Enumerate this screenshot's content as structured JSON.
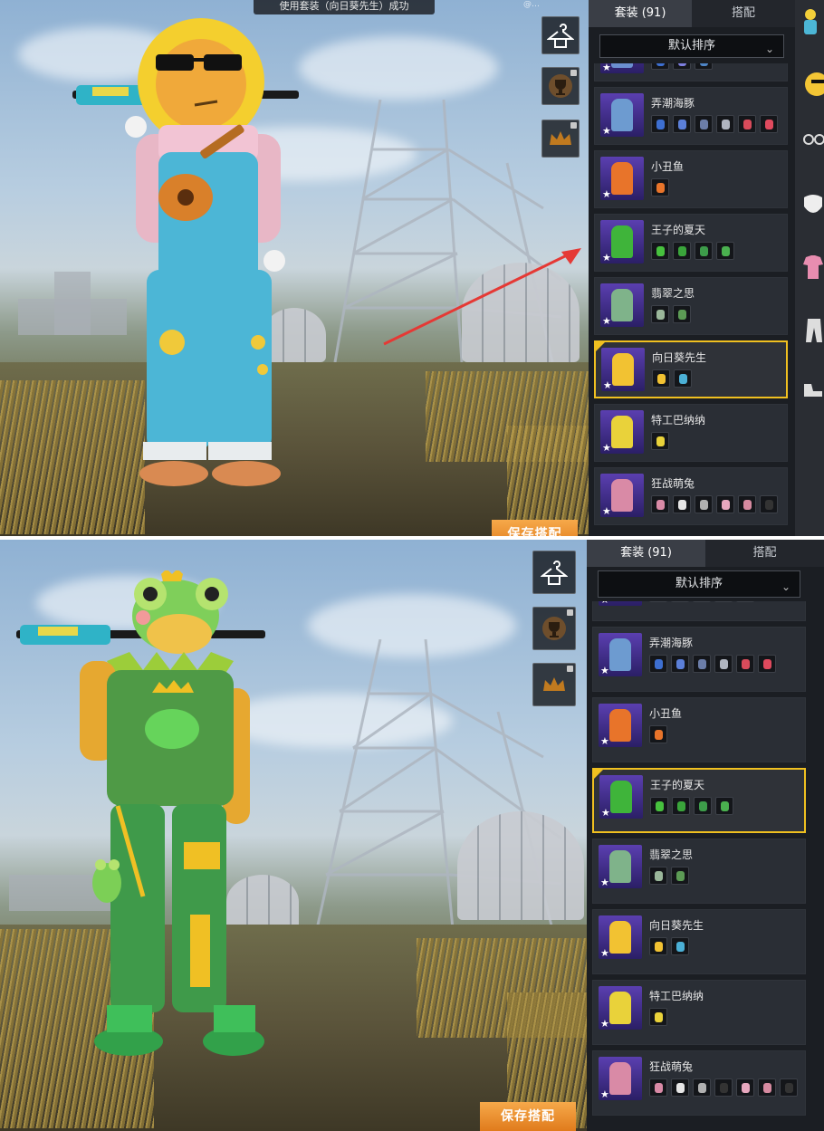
{
  "top": {
    "banner": "使用套装（向日葵先生）成功",
    "watermark": "@…",
    "tabs": [
      {
        "label": "套装 (91)",
        "active": true
      },
      {
        "label": "搭配",
        "active": false
      }
    ],
    "sort": "默认排序",
    "save": "保存搭配",
    "outfits": [
      {
        "name": "",
        "selected": false,
        "accent": "#6b8fd0",
        "parts": [
          "#3d6fd1",
          "#7e7fe0",
          "#4e86c8"
        ]
      },
      {
        "name": "弄潮海豚",
        "selected": false,
        "accent": "#6d9bd0",
        "parts": [
          "#3d6fd1",
          "#5b7fd8",
          "#6b7da8",
          "#b0b5c0",
          "#d94b5b",
          "#e04a5e"
        ]
      },
      {
        "name": "小丑鱼",
        "selected": false,
        "accent": "#e8742a",
        "parts": [
          "#e8742a"
        ]
      },
      {
        "name": "王子的夏天",
        "selected": false,
        "accent": "#3fb43a",
        "parts": [
          "#47c13e",
          "#3aa53b",
          "#3d9c4a",
          "#4ab04f"
        ]
      },
      {
        "name": "翡翠之思",
        "selected": false,
        "accent": "#7fb38a",
        "parts": [
          "#9ab79a",
          "#5c9b55"
        ]
      },
      {
        "name": "向日葵先生",
        "selected": true,
        "accent": "#f2c232",
        "parts": [
          "#f2c232",
          "#4bb0d6"
        ]
      },
      {
        "name": "特工巴纳纳",
        "selected": false,
        "accent": "#e9d23a",
        "parts": [
          "#e9d23a"
        ]
      },
      {
        "name": "狂战萌兔",
        "selected": false,
        "accent": "#d98aa6",
        "parts": [
          "#d98aa6",
          "#e6e6e6",
          "#b0b0b0",
          "#e7a7be",
          "#d68aa0",
          "#333333"
        ]
      }
    ]
  },
  "bottom": {
    "tabs": [
      {
        "label": "套装 (91)",
        "active": true
      },
      {
        "label": "搭配",
        "active": false
      }
    ],
    "sort": "默认排序",
    "save": "保存搭配",
    "outfits": [
      {
        "name": "",
        "selected": false,
        "accent": "#6b8fd0",
        "parts": [
          "#3d6fd1",
          "#7e7fe0",
          "#4e86c8",
          "#4e86c8",
          "#4e86c8"
        ]
      },
      {
        "name": "弄潮海豚",
        "selected": false,
        "accent": "#6d9bd0",
        "parts": [
          "#3d6fd1",
          "#5b7fd8",
          "#6b7da8",
          "#b0b5c0",
          "#d94b5b",
          "#e04a5e"
        ]
      },
      {
        "name": "小丑鱼",
        "selected": false,
        "accent": "#e8742a",
        "parts": [
          "#e8742a"
        ]
      },
      {
        "name": "王子的夏天",
        "selected": true,
        "accent": "#3fb43a",
        "parts": [
          "#47c13e",
          "#3aa53b",
          "#3d9c4a",
          "#4ab04f"
        ]
      },
      {
        "name": "翡翠之思",
        "selected": false,
        "accent": "#7fb38a",
        "parts": [
          "#9ab79a",
          "#5c9b55"
        ]
      },
      {
        "name": "向日葵先生",
        "selected": false,
        "accent": "#f2c232",
        "parts": [
          "#f2c232",
          "#4bb0d6"
        ]
      },
      {
        "name": "特工巴纳纳",
        "selected": false,
        "accent": "#e9d23a",
        "parts": [
          "#e9d23a"
        ]
      },
      {
        "name": "狂战萌兔",
        "selected": false,
        "accent": "#d98aa6",
        "parts": [
          "#d98aa6",
          "#e6e6e6",
          "#b0b0b0",
          "#333333",
          "#e7a7be",
          "#d68aa0",
          "#333333"
        ]
      }
    ]
  },
  "icons": {
    "wardrobe": "hanger-icon",
    "trophy": "trophy-icon",
    "crown": "crown-icon"
  },
  "colors": {
    "accent_orange": "#e07b1c",
    "selection_gold": "#f0c020",
    "arrow_red": "#e53935"
  }
}
